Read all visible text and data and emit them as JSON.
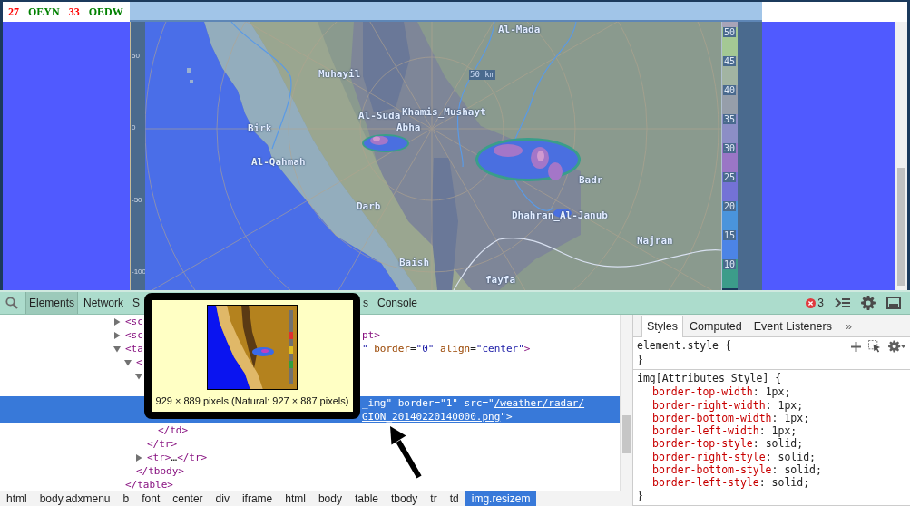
{
  "page": {
    "header": {
      "codes": [
        {
          "text": "27",
          "color": "#ff0000"
        },
        {
          "text": "OEYN",
          "color": "#008000"
        },
        {
          "text": "33",
          "color": "#ff0000"
        },
        {
          "text": "OEDW",
          "color": "#008000"
        }
      ]
    },
    "radar": {
      "axis_ticks": [
        "50",
        "0",
        "-50",
        "-100"
      ],
      "scale_label": "50 km",
      "places": [
        "Al-Mada",
        "Muhayil",
        "Al-Suda",
        "Khamis_Mushayt",
        "Abha",
        "Birk",
        "Al-Qahmah",
        "Badr",
        "Darb",
        "Dhahran_Al-Janub",
        "Najran",
        "Baish",
        "fayfa"
      ],
      "legend": [
        {
          "label": "50",
          "color": "#a4c894"
        },
        {
          "label": "45",
          "color": "#a2b4a2"
        },
        {
          "label": "40",
          "color": "#969eaa"
        },
        {
          "label": "35",
          "color": "#8c8ec6"
        },
        {
          "label": "30",
          "color": "#9a76c6"
        },
        {
          "label": "25",
          "color": "#7472d6"
        },
        {
          "label": "20",
          "color": "#4a94dc"
        },
        {
          "label": "15",
          "color": "#4c84e6"
        },
        {
          "label": "10",
          "color": "#3c9c8a"
        }
      ]
    }
  },
  "devtools": {
    "tab_groups": [
      {
        "tabs": [
          {
            "label": "Elements",
            "selected": true
          },
          {
            "label": "Network",
            "selected": false
          },
          {
            "label": "S",
            "selected": false
          }
        ]
      },
      {
        "tabs": [
          {
            "label": "s",
            "selected": false
          },
          {
            "label": "Console",
            "selected": false
          }
        ]
      }
    ],
    "error_count": "3",
    "tooltip": {
      "caption": "929 × 889 pixels (Natural: 927 × 887 pixels)"
    },
    "dom_tree": [
      {
        "selected": false,
        "expanded": false,
        "open": [
          {
            "kind": "tag",
            "text": "<sc"
          }
        ]
      },
      {
        "selected": false,
        "expanded": false,
        "open": [
          {
            "kind": "tag",
            "text": "<sc"
          }
        ],
        "open_after": [
          [
            {
              "kind": "tag",
              "text": "pt>"
            }
          ]
        ]
      },
      {
        "selected": false,
        "expanded": true,
        "open": [
          {
            "kind": "tag",
            "text": "<ta"
          }
        ],
        "open_after": [
          [
            {
              "kind": "value",
              "text": "\""
            },
            {
              "kind": "attr",
              "text": " border"
            },
            {
              "kind": "plain",
              "text": "="
            },
            {
              "kind": "value",
              "text": "\"0\""
            },
            {
              "kind": "attr",
              "text": " align"
            },
            {
              "kind": "plain",
              "text": "="
            },
            {
              "kind": "value",
              "text": "\"center\""
            },
            {
              "kind": "tag",
              "text": ">"
            }
          ]
        ],
        "close": [
          {
            "kind": "tag",
            "text": "</table>"
          }
        ],
        "children": [
          {
            "selected": false,
            "expanded": true,
            "open": [
              {
                "kind": "tag",
                "text": "<"
              }
            ],
            "close": [
              {
                "kind": "tag",
                "text": "</tbody>"
              }
            ],
            "children": [
              {
                "selected": false,
                "expanded": true,
                "close": [
                  {
                    "kind": "tag",
                    "text": "</tr>"
                  }
                ],
                "children": [
                  {
                    "selected": false,
                    "close": [
                      {
                        "kind": "tag",
                        "text": "</td>"
                      }
                    ],
                    "children": [
                      {
                        "selected": true,
                        "open_after": [
                          [
                            {
                              "kind": "value",
                              "text": "_img\""
                            },
                            {
                              "kind": "attr",
                              "text": " border"
                            },
                            {
                              "kind": "plain",
                              "text": "="
                            },
                            {
                              "kind": "value",
                              "text": "\"1\""
                            },
                            {
                              "kind": "attr",
                              "text": " src"
                            },
                            {
                              "kind": "plain",
                              "text": "="
                            },
                            {
                              "kind": "value",
                              "text": "\""
                            },
                            {
                              "kind": "link",
                              "text": "/weather/radar/"
                            }
                          ],
                          [
                            {
                              "kind": "link",
                              "text": "GION_20140220140000.png"
                            },
                            {
                              "kind": "value",
                              "text": "\""
                            },
                            {
                              "kind": "tag",
                              "text": ">"
                            }
                          ]
                        ]
                      }
                    ]
                  }
                ]
              },
              {
                "selected": false,
                "expanded": false,
                "open": [
                  {
                    "kind": "tag",
                    "text": "<tr>"
                  },
                  {
                    "kind": "plain",
                    "text": "…"
                  },
                  {
                    "kind": "tag",
                    "text": "</tr>"
                  }
                ]
              }
            ]
          }
        ]
      }
    ],
    "breadcrumbs": [
      {
        "label": "html",
        "selected": false
      },
      {
        "label": "body.adxmenu",
        "selected": false
      },
      {
        "label": "b",
        "selected": false
      },
      {
        "label": "font",
        "selected": false
      },
      {
        "label": "center",
        "selected": false
      },
      {
        "label": "div",
        "selected": false
      },
      {
        "label": "iframe",
        "selected": false
      },
      {
        "label": "html",
        "selected": false
      },
      {
        "label": "body",
        "selected": false
      },
      {
        "label": "table",
        "selected": false
      },
      {
        "label": "tbody",
        "selected": false
      },
      {
        "label": "tr",
        "selected": false
      },
      {
        "label": "td",
        "selected": false
      },
      {
        "label": "img.resizem",
        "selected": true
      }
    ],
    "styles": {
      "tabs": [
        {
          "label": "Styles",
          "selected": true
        },
        {
          "label": "Computed",
          "selected": false
        },
        {
          "label": "Event Listeners",
          "selected": false
        }
      ],
      "more": "»",
      "rules": [
        {
          "selector": "element.style {",
          "close": "}"
        },
        {
          "selector": "img[Attributes Style] {",
          "close": "}",
          "declarations": [
            {
              "name": "border-top-width",
              "value": ": 1px;"
            },
            {
              "name": "border-right-width",
              "value": ": 1px;"
            },
            {
              "name": "border-bottom-width",
              "value": ": 1px;"
            },
            {
              "name": "border-left-width",
              "value": ": 1px;"
            },
            {
              "name": "border-top-style",
              "value": ": solid;"
            },
            {
              "name": "border-right-style",
              "value": ": solid;"
            },
            {
              "name": "border-bottom-style",
              "value": ": solid;"
            },
            {
              "name": "border-left-style",
              "value": ": solid;"
            }
          ]
        }
      ]
    }
  }
}
